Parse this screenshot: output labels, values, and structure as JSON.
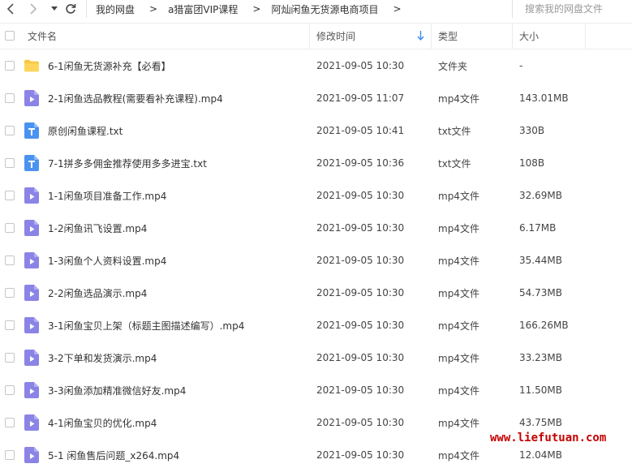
{
  "breadcrumbs": [
    "我的网盘",
    "a猎富团VIP课程",
    "阿灿闲鱼无货源电商项目"
  ],
  "search": {
    "placeholder": "搜索我的网盘文件"
  },
  "columns": {
    "name": "文件名",
    "time": "修改时间",
    "type": "类型",
    "size": "大小"
  },
  "files": [
    {
      "icon": "folder-icon",
      "name": "6-1闲鱼无货源补充【必看】",
      "time": "2021-09-05 10:30",
      "type": "文件夹",
      "size": "-"
    },
    {
      "icon": "video-file-icon",
      "name": "2-1闲鱼选品教程(需要看补充课程).mp4",
      "time": "2021-09-05 11:07",
      "type": "mp4文件",
      "size": "143.01MB"
    },
    {
      "icon": "text-file-icon",
      "name": "原创闲鱼课程.txt",
      "time": "2021-09-05 10:41",
      "type": "txt文件",
      "size": "330B"
    },
    {
      "icon": "text-file-icon",
      "name": "7-1拼多多佣金推荐使用多多进宝.txt",
      "time": "2021-09-05 10:36",
      "type": "txt文件",
      "size": "108B"
    },
    {
      "icon": "video-file-icon",
      "name": "1-1闲鱼项目准备工作.mp4",
      "time": "2021-09-05 10:30",
      "type": "mp4文件",
      "size": "32.69MB"
    },
    {
      "icon": "video-file-icon",
      "name": "1-2闲鱼讯飞设置.mp4",
      "time": "2021-09-05 10:30",
      "type": "mp4文件",
      "size": "6.17MB"
    },
    {
      "icon": "video-file-icon",
      "name": "1-3闲鱼个人资料设置.mp4",
      "time": "2021-09-05 10:30",
      "type": "mp4文件",
      "size": "35.44MB"
    },
    {
      "icon": "video-file-icon",
      "name": "2-2闲鱼选品演示.mp4",
      "time": "2021-09-05 10:30",
      "type": "mp4文件",
      "size": "54.73MB"
    },
    {
      "icon": "video-file-icon",
      "name": "3-1闲鱼宝贝上架（标题主图描述编写）.mp4",
      "time": "2021-09-05 10:30",
      "type": "mp4文件",
      "size": "166.26MB"
    },
    {
      "icon": "video-file-icon",
      "name": "3-2下单和发货演示.mp4",
      "time": "2021-09-05 10:30",
      "type": "mp4文件",
      "size": "33.23MB"
    },
    {
      "icon": "video-file-icon",
      "name": "3-3闲鱼添加精准微信好友.mp4",
      "time": "2021-09-05 10:30",
      "type": "mp4文件",
      "size": "11.50MB"
    },
    {
      "icon": "video-file-icon",
      "name": "4-1闲鱼宝贝的优化.mp4",
      "time": "2021-09-05 10:30",
      "type": "mp4文件",
      "size": "43.75MB"
    },
    {
      "icon": "video-file-icon",
      "name": "5-1 闲鱼售后问题_x264.mp4",
      "time": "2021-09-05 10:30",
      "type": "mp4文件",
      "size": "12.04MB"
    }
  ],
  "watermark": "www.liefutuan.com",
  "colors": {
    "folder": "#f7c846",
    "video": "#8b84e6",
    "text": "#4b93f0",
    "watermark": "#c40000"
  }
}
